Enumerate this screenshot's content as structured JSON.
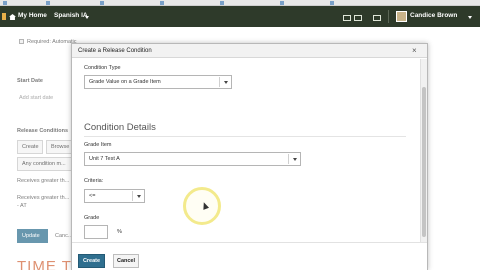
{
  "navbar": {
    "home_label": "My Home",
    "course_label": "Spanish IA",
    "user_name": "Candice Brown"
  },
  "background": {
    "required_text": "Required: Automatic",
    "start_label": "Start Date",
    "start_placeholder": "Add start date",
    "release_label": "Release Conditions",
    "create_btn": "Create",
    "browse_btn": "Browse",
    "any_condition": "Any condition m...",
    "receives_1": "Receives greater th...",
    "receives_2": "Receives greater th...",
    "at_text": "- AT",
    "update_btn": "Update",
    "cancel_btn": "Canc...",
    "big_heading": "TIME T"
  },
  "dialog": {
    "title": "Create a Release Condition",
    "close_glyph": "×",
    "condition_type_label": "Condition Type",
    "condition_type_value": "Grade Value on a Grade Item",
    "section_title": "Condition Details",
    "grade_item_label": "Grade Item",
    "grade_item_value": "Unit 7 Test A",
    "criteria_label": "Criteria:",
    "criteria_value": "<=",
    "grade_label": "Grade",
    "grade_value": "",
    "percent_sign": "%",
    "create_label": "Create",
    "cancel_label": "Cancel"
  }
}
